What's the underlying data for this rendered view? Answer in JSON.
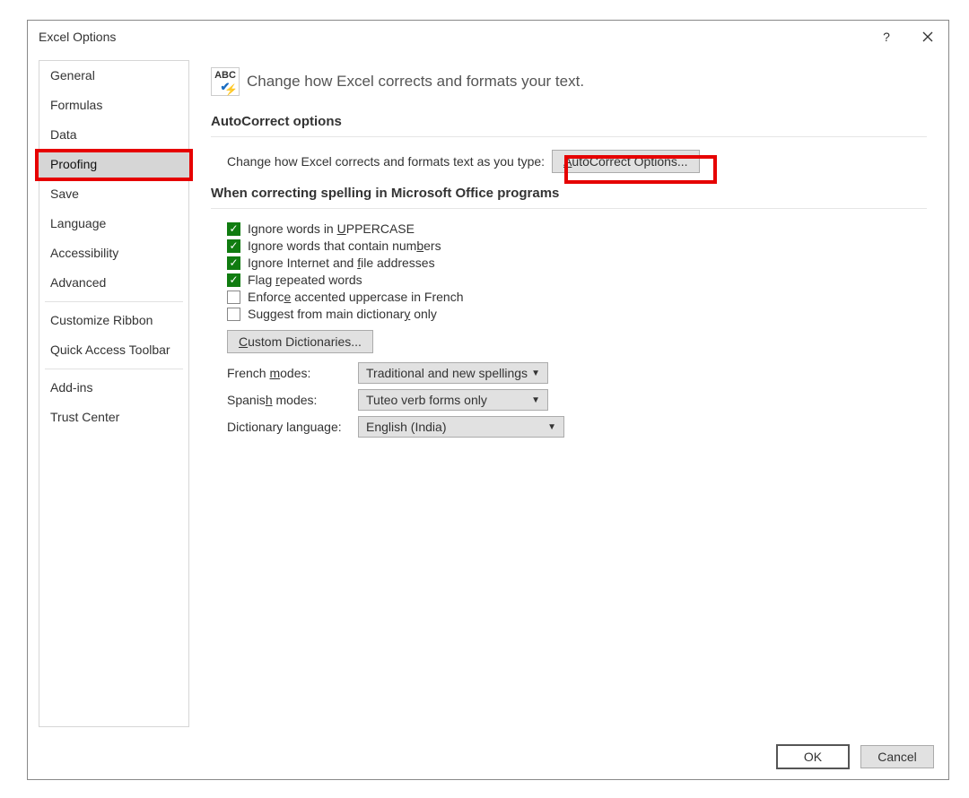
{
  "window": {
    "title": "Excel Options"
  },
  "sidebar": {
    "items": [
      {
        "label": "General"
      },
      {
        "label": "Formulas"
      },
      {
        "label": "Data"
      },
      {
        "label": "Proofing",
        "selected": true
      },
      {
        "label": "Save"
      },
      {
        "label": "Language"
      },
      {
        "label": "Accessibility"
      },
      {
        "label": "Advanced"
      },
      {
        "label": "Customize Ribbon"
      },
      {
        "label": "Quick Access Toolbar"
      },
      {
        "label": "Add-ins"
      },
      {
        "label": "Trust Center"
      }
    ]
  },
  "main": {
    "icon_abc": "ABC",
    "heading": "Change how Excel corrects and formats your text.",
    "section1": "AutoCorrect options",
    "autocorrect_text": "Change how Excel corrects and formats text as you type:",
    "autocorrect_button_pre": "A",
    "autocorrect_button_post": "utoCorrect Options...",
    "section2": "When correcting spelling in Microsoft Office programs",
    "checks": {
      "uppercase_pre": "Ignore words in ",
      "uppercase_u": "U",
      "uppercase_post": "PPERCASE",
      "numbers_pre": "Ignore words that contain num",
      "numbers_u": "b",
      "numbers_post": "ers",
      "internet_pre": "Ignore Internet and ",
      "internet_u": "f",
      "internet_post": "ile addresses",
      "repeated_pre": "Flag ",
      "repeated_u": "r",
      "repeated_post": "epeated words",
      "french_pre": "Enforc",
      "french_u": "e",
      "french_post": " accented uppercase in French",
      "mainonly_pre": "Suggest from main dictionar",
      "mainonly_u": "y",
      "mainonly_post": " only"
    },
    "custom_dict_u": "C",
    "custom_dict_post": "ustom Dictionaries...",
    "french_modes_label_pre": "French ",
    "french_modes_label_u": "m",
    "french_modes_label_post": "odes:",
    "french_modes_value": "Traditional and new spellings",
    "spanish_modes_label_pre": "Spanis",
    "spanish_modes_label_u": "h",
    "spanish_modes_label_post": " modes:",
    "spanish_modes_value": "Tuteo verb forms only",
    "dict_lang_label": "Dictionary language:",
    "dict_lang_value": "English (India)"
  },
  "footer": {
    "ok": "OK",
    "cancel": "Cancel"
  }
}
